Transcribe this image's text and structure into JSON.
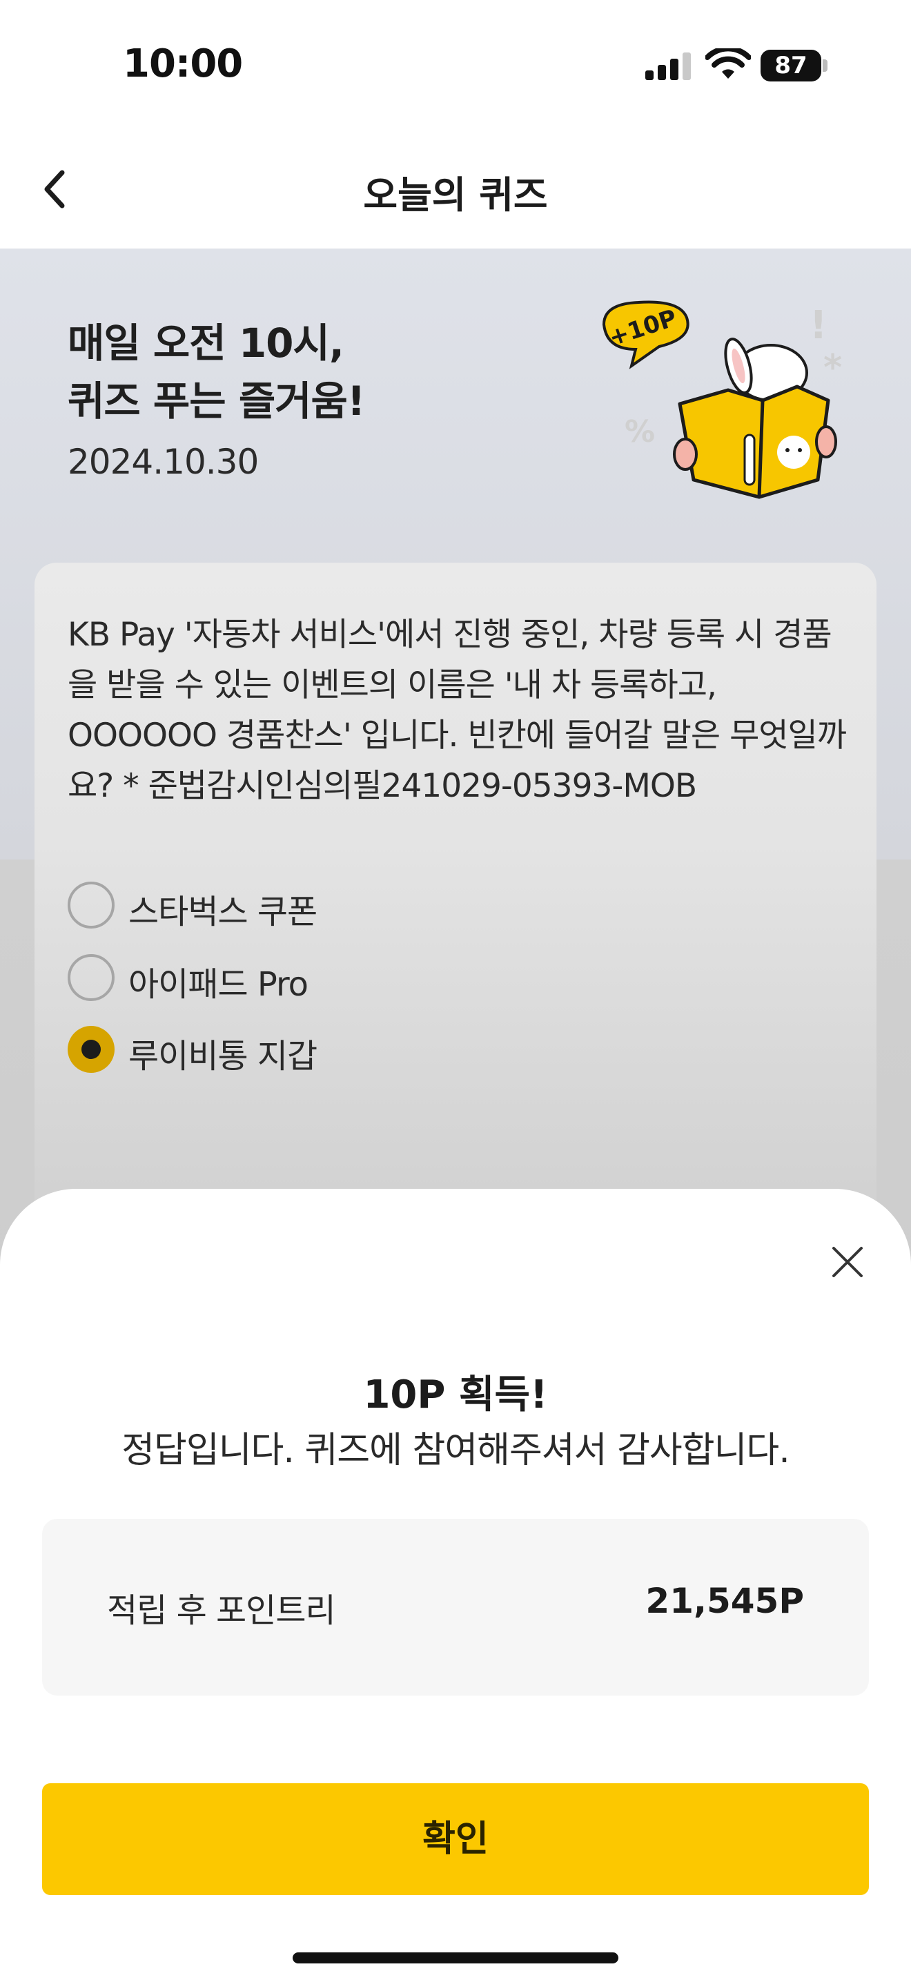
{
  "status_bar": {
    "time": "10:00",
    "battery": "87"
  },
  "nav": {
    "title": "오늘의 퀴즈",
    "back_icon": "chevron-left-icon"
  },
  "hero": {
    "title_line1": "매일 오전 10시,",
    "title_line2": "퀴즈 푸는 즐거움!",
    "date": "2024.10.30",
    "badge": "+10P",
    "illustration": "rabbit-reading-book-icon"
  },
  "quiz": {
    "question": "KB Pay '자동차 서비스'에서 진행 중인, 차량 등록 시 경품을 받을 수 있는 이벤트의 이름은 '내 차 등록하고, OOOOOO 경품찬스' 입니다. 빈칸에 들어갈 말은 무엇일까요? * 준법감시인심의필241029-05393-MOB",
    "options": [
      {
        "label": "스타벅스 쿠폰",
        "selected": false
      },
      {
        "label": "아이패드 Pro",
        "selected": false
      },
      {
        "label": "루이비통 지갑",
        "selected": true
      }
    ]
  },
  "result_sheet": {
    "title": "10P 획득!",
    "message": "정답입니다. 퀴즈에 참여해주셔서 감사합니다.",
    "points_label": "적립 후 포인트리",
    "points_value": "21,545P",
    "confirm_label": "확인",
    "close_icon": "close-icon"
  },
  "colors": {
    "accent_yellow": "#FCC800",
    "selected_radio": "#D6A400",
    "hero_background": "#DFE2E9"
  }
}
